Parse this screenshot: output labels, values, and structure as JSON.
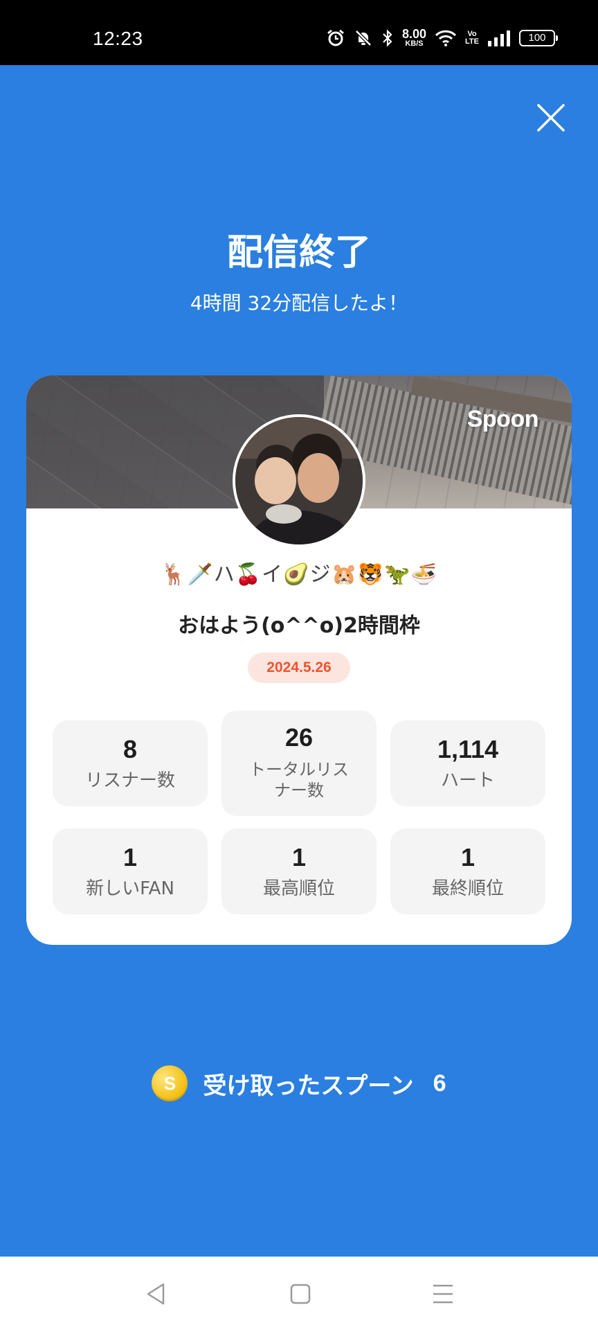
{
  "status_bar": {
    "time": "12:23",
    "net_speed": "8.00",
    "net_unit": "KB/S",
    "volte_top": "Vo",
    "volte_bottom": "LTE",
    "battery": "100",
    "icons": [
      "alarm-icon",
      "mute-icon",
      "bluetooth-icon",
      "wifi-icon",
      "signal-icon",
      "battery-icon"
    ]
  },
  "header": {
    "close_icon": "close-icon",
    "title": "配信終了",
    "subtitle": "4時間 32分配信したよ！"
  },
  "card": {
    "brand": "Spoon",
    "dj_name": "🦌🗡️ハ🍒イ🥑ジ🐹🐯🦖🍜",
    "broadcast_title": "おはよう(o^^o)2時間枠",
    "date": "2024.5.26",
    "stats": [
      {
        "value": "8",
        "label": "リスナー数"
      },
      {
        "value": "26",
        "label": "トータルリスナー数"
      },
      {
        "value": "1,114",
        "label": "ハート"
      },
      {
        "value": "1",
        "label": "新しいFAN"
      },
      {
        "value": "1",
        "label": "最高順位"
      },
      {
        "value": "1",
        "label": "最終順位"
      }
    ]
  },
  "spoons": {
    "coin_symbol": "S",
    "label": "受け取ったスプーン",
    "count": "6"
  },
  "colors": {
    "background": "#2a7fe0",
    "date_badge_bg": "#fde5df",
    "date_badge_text": "#f0532d",
    "coin": "#f5c21b"
  },
  "nav": {
    "icons": [
      "back-icon",
      "home-icon",
      "menu-icon"
    ]
  }
}
